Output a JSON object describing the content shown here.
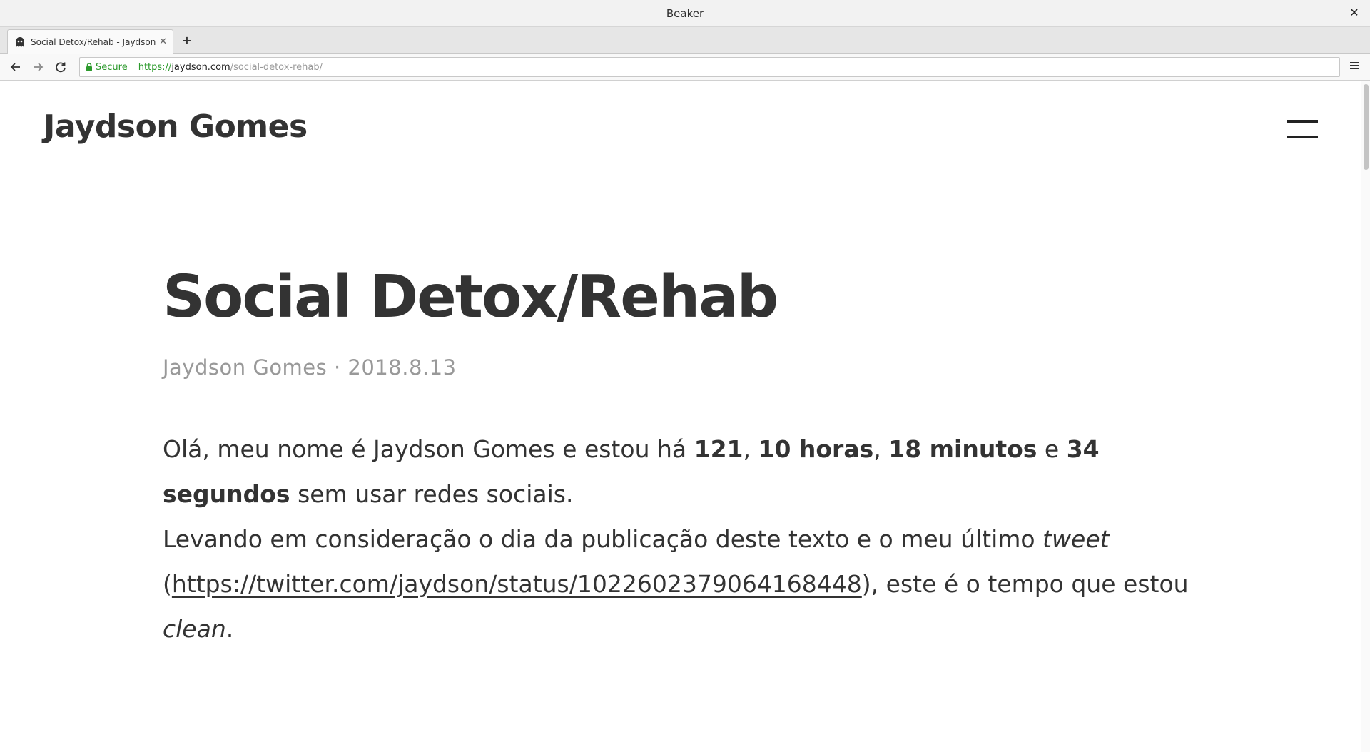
{
  "window": {
    "title": "Beaker"
  },
  "tabs": [
    {
      "label": "Social Detox/Rehab - Jaydson G..."
    }
  ],
  "nav": {
    "secure_label": "Secure",
    "url_scheme": "https://",
    "url_host": "jaydson.com",
    "url_path": "/social-detox-rehab/"
  },
  "site": {
    "title": "Jaydson Gomes"
  },
  "post": {
    "title": "Social Detox/Rehab",
    "author": "Jaydson Gomes",
    "meta_sep": "·",
    "date": "2018.8.13",
    "p1": {
      "intro": "Olá, meu nome é Jaydson Gomes e estou há ",
      "days": "121",
      "comma1": ", ",
      "hours": "10 horas",
      "comma2": ", ",
      "minutes": "18 minutos",
      "and": " e ",
      "seconds": "34 segundos",
      "outro": " sem usar redes sociais."
    },
    "p2": {
      "intro": "Levando em consideração o dia da publicação deste texto e o meu último ",
      "tweet_word": "tweet",
      "open_paren": " (",
      "link": "https://twitter.com/jaydson/status/1022602379064168448",
      "after_link": "), este é o tempo que estou ",
      "clean_word": "clean",
      "period": "."
    }
  },
  "colors": {
    "text": "#333333",
    "meta": "#999999",
    "secure_green": "#2d9a2d"
  }
}
